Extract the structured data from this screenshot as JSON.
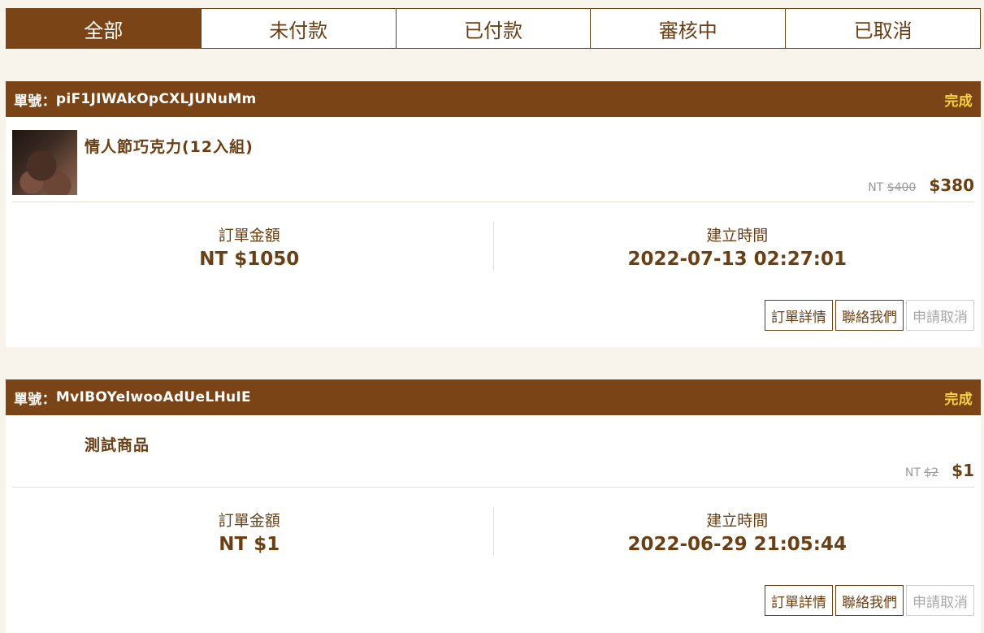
{
  "tabs": [
    {
      "label": "全部",
      "active": true
    },
    {
      "label": "未付款",
      "active": false
    },
    {
      "label": "已付款",
      "active": false
    },
    {
      "label": "審核中",
      "active": false
    },
    {
      "label": "已取消",
      "active": false
    }
  ],
  "orders": [
    {
      "id_label": "單號：",
      "id": "piF1JIWAkOpCXLJUNuMm",
      "status": "完成",
      "item": {
        "name": "情人節巧克力(12入組)",
        "thumbnail": "chocolate-image",
        "orig_currency": "NT ",
        "orig_price": "$400",
        "sale_price": "$380"
      },
      "total_label": "訂單金額",
      "total_value": "NT $1050",
      "created_label": "建立時間",
      "created_value": "2022-07-13 02:27:01",
      "actions": {
        "detail": "訂單詳情",
        "contact": "聯絡我們",
        "cancel": "申請取消"
      }
    },
    {
      "id_label": "單號：",
      "id": "MvIBOYelwooAdUeLHuIE",
      "status": "完成",
      "item": {
        "name": "測試商品",
        "orig_currency": "NT ",
        "orig_price": "$2",
        "sale_price": "$1"
      },
      "total_label": "訂單金額",
      "total_value": "NT $1",
      "created_label": "建立時間",
      "created_value": "2022-06-29 21:05:44",
      "actions": {
        "detail": "訂單詳情",
        "contact": "聯絡我們",
        "cancel": "申請取消"
      }
    }
  ],
  "colors": {
    "brand": "#7a4416",
    "status": "#f7d23e",
    "text": "#6b3f14",
    "background": "#f8f4ec"
  }
}
